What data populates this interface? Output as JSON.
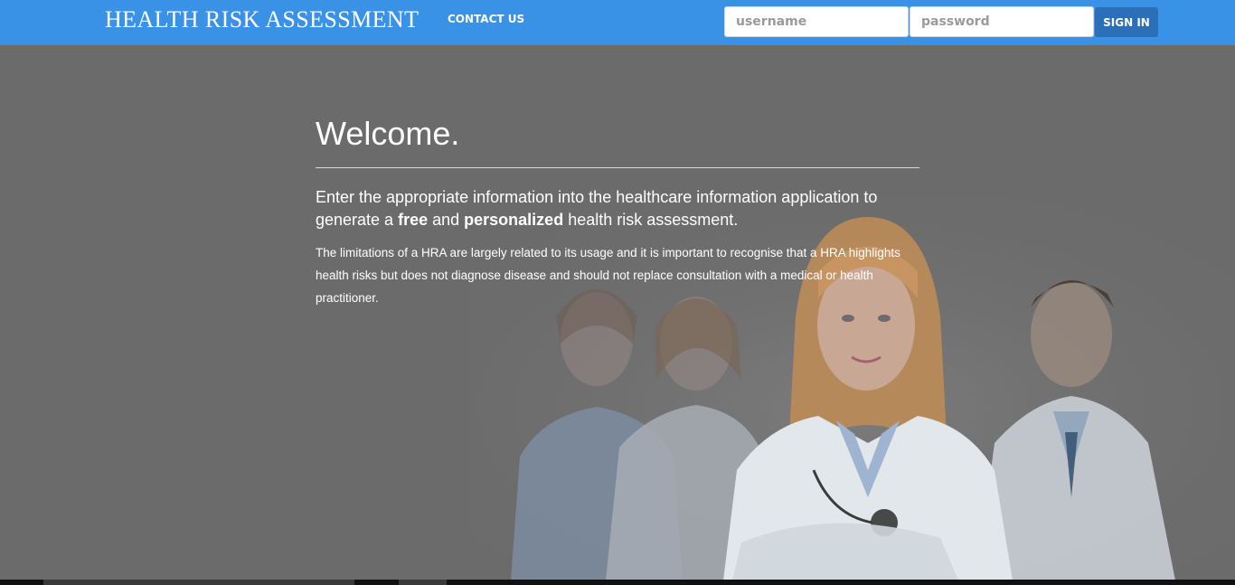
{
  "navbar": {
    "brand": "HEALTH RISK ASSESSMENT",
    "contact_label": "CONTACT US",
    "username_placeholder": "username",
    "password_placeholder": "password",
    "signin_label": "SIGN IN",
    "background_color": "#3a92e6",
    "button_color": "#2a6fb8"
  },
  "hero": {
    "title": "Welcome.",
    "lead_part1": "Enter the appropriate information into the healthcare information application to generate a ",
    "lead_bold1": "free",
    "lead_part2": " and ",
    "lead_bold2": "personalized",
    "lead_part3": " health risk assessment.",
    "note": "The limitations of a HRA are largely related to its usage and it is important to recognise that a HRA highlights health risks but does not diagnose disease and should not replace consultation with a medical or health practitioner.",
    "overlay_color": "#6b6b6b",
    "image_subject": "medical-staff-group-photo"
  }
}
